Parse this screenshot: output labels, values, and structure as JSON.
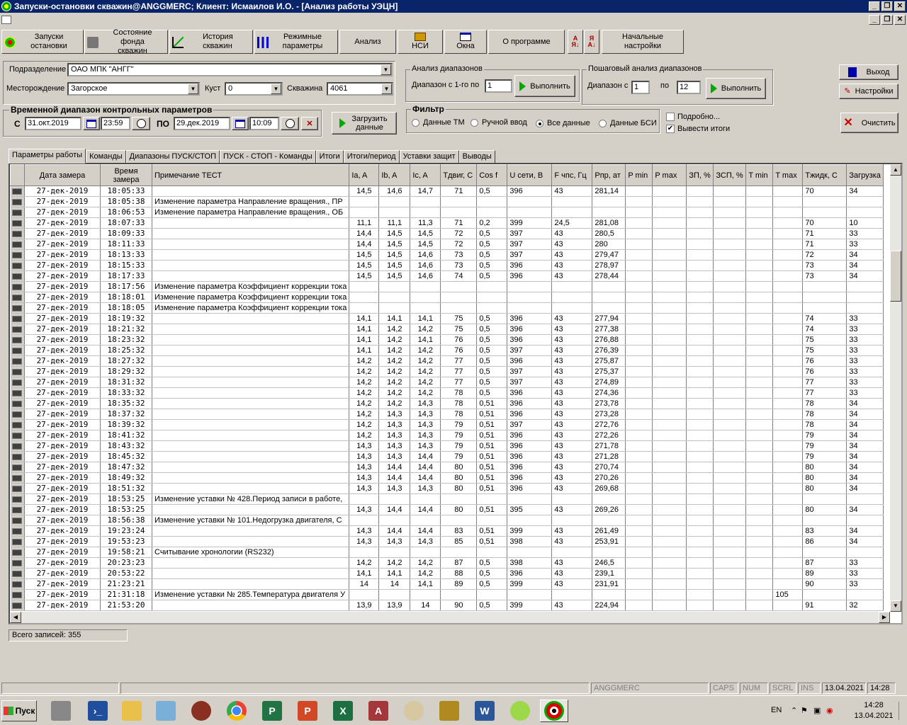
{
  "window": {
    "title": "Запуски-остановки скважин@ANGGMERC;  Клиент: Исмаилов И.О. - [Анализ работы УЭЦН]"
  },
  "toolbar": {
    "starts_stops": "Запуски остановки",
    "well_stock_state": "Состояние фонда скважин",
    "well_history": "История скважин",
    "mode_params": "Режимные параметры",
    "analysis": "Анализ",
    "nsi": "НСИ",
    "windows": "Окна",
    "about": "О программе",
    "initial_settings": "Начальные настройки"
  },
  "filters": {
    "subdivision_label": "Подразделение",
    "subdivision_value": "ОАО МПК \"АНГГ\"",
    "field_label": "Месторождение",
    "field_value": "Загорское",
    "cluster_label": "Куст",
    "cluster_value": "0",
    "well_label": "Скважина",
    "well_value": "4061"
  },
  "time_range": {
    "title": "Временной диапазон контрольных параметров",
    "from_label": "С",
    "from_date": "31.окт.2019",
    "from_time": "23:59",
    "to_label": "ПО",
    "to_date": "29.дек.2019",
    "to_time": "10:09",
    "load_button": "Загрузить данные"
  },
  "range_analysis": {
    "title": "Анализ диапазонов",
    "label": "Диапазон с 1-го по",
    "value": "1",
    "run": "Выполнить"
  },
  "step_analysis": {
    "title": "Пошаговый анализ диапазонов",
    "label_from": "Диапазон с",
    "from_value": "1",
    "label_to": "по",
    "to_value": "12",
    "run": "Выполнить"
  },
  "filter": {
    "title": "Фильтр",
    "options": [
      "Данные ТМ",
      "Ручной ввод",
      "Все данные",
      "Данные БСИ"
    ],
    "selected": "Все данные",
    "detailed_label": "Подробно...",
    "detailed_checked": false,
    "totals_label": "Вывести итоги",
    "totals_checked": true
  },
  "right_buttons": {
    "exit": "Выход",
    "settings": "Настройки",
    "clear": "Очистить"
  },
  "tabs": [
    "Параметры работы",
    "Команды",
    "Диапазоны ПУСК/СТОП",
    "ПУСК - СТОП - Команды",
    "Итоги",
    "Итоги/период",
    "Уставки защит",
    "Выводы"
  ],
  "active_tab": "Параметры работы",
  "grid": {
    "columns": [
      "Дата замера",
      "Время замера",
      "Примечание ТЕСТ",
      "Ia, A",
      "Ib, A",
      "Ic, A",
      "Тдвиг, С",
      "Cos f",
      "U сети, В",
      "F чпс, Гц",
      "Рпр, ат",
      "P min",
      "P max",
      "ЗП, %",
      "ЗСП, %",
      "T min",
      "T max",
      "Тжидк, С",
      "Загрузка"
    ],
    "rows": [
      [
        "27-дек-2019",
        "18:05:33",
        "",
        "14,5",
        "14,6",
        "14,7",
        "71",
        "0,5",
        "396",
        "43",
        "281,14",
        "",
        "",
        "",
        "",
        "",
        "",
        "70",
        "34"
      ],
      [
        "27-дек-2019",
        "18:05:38",
        "Изменение параметра Направление вращения.,   ПР",
        "",
        "",
        "",
        "",
        "",
        "",
        "",
        "",
        "",
        "",
        "",
        "",
        "",
        "",
        "",
        ""
      ],
      [
        "27-дек-2019",
        "18:06:53",
        "Изменение параметра Направление вращения.,   ОБ",
        "",
        "",
        "",
        "",
        "",
        "",
        "",
        "",
        "",
        "",
        "",
        "",
        "",
        "",
        "",
        ""
      ],
      [
        "27-дек-2019",
        "18:07:33",
        "",
        "11,1",
        "11,1",
        "11,3",
        "71",
        "0,2",
        "399",
        "24,5",
        "281,08",
        "",
        "",
        "",
        "",
        "",
        "",
        "70",
        "10"
      ],
      [
        "27-дек-2019",
        "18:09:33",
        "",
        "14,4",
        "14,5",
        "14,5",
        "72",
        "0,5",
        "397",
        "43",
        "280,5",
        "",
        "",
        "",
        "",
        "",
        "",
        "71",
        "33"
      ],
      [
        "27-дек-2019",
        "18:11:33",
        "",
        "14,4",
        "14,5",
        "14,5",
        "72",
        "0,5",
        "397",
        "43",
        "280",
        "",
        "",
        "",
        "",
        "",
        "",
        "71",
        "33"
      ],
      [
        "27-дек-2019",
        "18:13:33",
        "",
        "14,5",
        "14,5",
        "14,6",
        "73",
        "0,5",
        "397",
        "43",
        "279,47",
        "",
        "",
        "",
        "",
        "",
        "",
        "72",
        "34"
      ],
      [
        "27-дек-2019",
        "18:15:33",
        "",
        "14,5",
        "14,5",
        "14,6",
        "73",
        "0,5",
        "396",
        "43",
        "278,97",
        "",
        "",
        "",
        "",
        "",
        "",
        "73",
        "34"
      ],
      [
        "27-дек-2019",
        "18:17:33",
        "",
        "14,5",
        "14,5",
        "14,6",
        "74",
        "0,5",
        "396",
        "43",
        "278,44",
        "",
        "",
        "",
        "",
        "",
        "",
        "73",
        "34"
      ],
      [
        "27-дек-2019",
        "18:17:56",
        "Изменение параметра Коэффициент коррекции тока",
        "",
        "",
        "",
        "",
        "",
        "",
        "",
        "",
        "",
        "",
        "",
        "",
        "",
        "",
        "",
        ""
      ],
      [
        "27-дек-2019",
        "18:18:01",
        "Изменение параметра Коэффициент коррекции тока",
        "",
        "",
        "",
        "",
        "",
        "",
        "",
        "",
        "",
        "",
        "",
        "",
        "",
        "",
        "",
        ""
      ],
      [
        "27-дек-2019",
        "18:18:05",
        "Изменение параметра Коэффициент коррекции тока",
        "",
        "",
        "",
        "",
        "",
        "",
        "",
        "",
        "",
        "",
        "",
        "",
        "",
        "",
        "",
        ""
      ],
      [
        "27-дек-2019",
        "18:19:32",
        "",
        "14,1",
        "14,1",
        "14,1",
        "75",
        "0,5",
        "396",
        "43",
        "277,94",
        "",
        "",
        "",
        "",
        "",
        "",
        "74",
        "33"
      ],
      [
        "27-дек-2019",
        "18:21:32",
        "",
        "14,1",
        "14,2",
        "14,2",
        "75",
        "0,5",
        "396",
        "43",
        "277,38",
        "",
        "",
        "",
        "",
        "",
        "",
        "74",
        "33"
      ],
      [
        "27-дек-2019",
        "18:23:32",
        "",
        "14,1",
        "14,2",
        "14,1",
        "76",
        "0,5",
        "396",
        "43",
        "276,88",
        "",
        "",
        "",
        "",
        "",
        "",
        "75",
        "33"
      ],
      [
        "27-дек-2019",
        "18:25:32",
        "",
        "14,1",
        "14,2",
        "14,2",
        "76",
        "0,5",
        "397",
        "43",
        "276,39",
        "",
        "",
        "",
        "",
        "",
        "",
        "75",
        "33"
      ],
      [
        "27-дек-2019",
        "18:27:32",
        "",
        "14,2",
        "14,2",
        "14,2",
        "77",
        "0,5",
        "396",
        "43",
        "275,87",
        "",
        "",
        "",
        "",
        "",
        "",
        "76",
        "33"
      ],
      [
        "27-дек-2019",
        "18:29:32",
        "",
        "14,2",
        "14,2",
        "14,2",
        "77",
        "0,5",
        "397",
        "43",
        "275,37",
        "",
        "",
        "",
        "",
        "",
        "",
        "76",
        "33"
      ],
      [
        "27-дек-2019",
        "18:31:32",
        "",
        "14,2",
        "14,2",
        "14,2",
        "77",
        "0,5",
        "397",
        "43",
        "274,89",
        "",
        "",
        "",
        "",
        "",
        "",
        "77",
        "33"
      ],
      [
        "27-дек-2019",
        "18:33:32",
        "",
        "14,2",
        "14,2",
        "14,2",
        "78",
        "0,5",
        "396",
        "43",
        "274,36",
        "",
        "",
        "",
        "",
        "",
        "",
        "77",
        "33"
      ],
      [
        "27-дек-2019",
        "18:35:32",
        "",
        "14,2",
        "14,2",
        "14,3",
        "78",
        "0,51",
        "396",
        "43",
        "273,78",
        "",
        "",
        "",
        "",
        "",
        "",
        "78",
        "34"
      ],
      [
        "27-дек-2019",
        "18:37:32",
        "",
        "14,2",
        "14,3",
        "14,3",
        "78",
        "0,51",
        "396",
        "43",
        "273,28",
        "",
        "",
        "",
        "",
        "",
        "",
        "78",
        "34"
      ],
      [
        "27-дек-2019",
        "18:39:32",
        "",
        "14,2",
        "14,3",
        "14,3",
        "79",
        "0,51",
        "397",
        "43",
        "272,76",
        "",
        "",
        "",
        "",
        "",
        "",
        "78",
        "34"
      ],
      [
        "27-дек-2019",
        "18:41:32",
        "",
        "14,2",
        "14,3",
        "14,3",
        "79",
        "0,51",
        "396",
        "43",
        "272,26",
        "",
        "",
        "",
        "",
        "",
        "",
        "79",
        "34"
      ],
      [
        "27-дек-2019",
        "18:43:32",
        "",
        "14,3",
        "14,3",
        "14,3",
        "79",
        "0,51",
        "396",
        "43",
        "271,78",
        "",
        "",
        "",
        "",
        "",
        "",
        "79",
        "34"
      ],
      [
        "27-дек-2019",
        "18:45:32",
        "",
        "14,3",
        "14,3",
        "14,4",
        "79",
        "0,51",
        "396",
        "43",
        "271,28",
        "",
        "",
        "",
        "",
        "",
        "",
        "79",
        "34"
      ],
      [
        "27-дек-2019",
        "18:47:32",
        "",
        "14,3",
        "14,4",
        "14,4",
        "80",
        "0,51",
        "396",
        "43",
        "270,74",
        "",
        "",
        "",
        "",
        "",
        "",
        "80",
        "34"
      ],
      [
        "27-дек-2019",
        "18:49:32",
        "",
        "14,3",
        "14,4",
        "14,4",
        "80",
        "0,51",
        "396",
        "43",
        "270,26",
        "",
        "",
        "",
        "",
        "",
        "",
        "80",
        "34"
      ],
      [
        "27-дек-2019",
        "18:51:32",
        "",
        "14,3",
        "14,3",
        "14,3",
        "80",
        "0,51",
        "396",
        "43",
        "269,68",
        "",
        "",
        "",
        "",
        "",
        "",
        "80",
        "34"
      ],
      [
        "27-дек-2019",
        "18:53:25",
        "Изменение уставки № 428.Период записи  в работе,",
        "",
        "",
        "",
        "",
        "",
        "",
        "",
        "",
        "",
        "",
        "",
        "",
        "",
        "",
        "",
        ""
      ],
      [
        "27-дек-2019",
        "18:53:25",
        "",
        "14,3",
        "14,4",
        "14,4",
        "80",
        "0,51",
        "395",
        "43",
        "269,26",
        "",
        "",
        "",
        "",
        "",
        "",
        "80",
        "34"
      ],
      [
        "27-дек-2019",
        "18:56:38",
        "Изменение уставки № 101.Недогрузка двигателя,   С",
        "",
        "",
        "",
        "",
        "",
        "",
        "",
        "",
        "",
        "",
        "",
        "",
        "",
        "",
        "",
        ""
      ],
      [
        "27-дек-2019",
        "19:23:24",
        "",
        "14,3",
        "14,4",
        "14,4",
        "83",
        "0,51",
        "399",
        "43",
        "261,49",
        "",
        "",
        "",
        "",
        "",
        "",
        "83",
        "34"
      ],
      [
        "27-дек-2019",
        "19:53:23",
        "",
        "14,3",
        "14,3",
        "14,3",
        "85",
        "0,51",
        "398",
        "43",
        "253,91",
        "",
        "",
        "",
        "",
        "",
        "",
        "86",
        "34"
      ],
      [
        "27-дек-2019",
        "19:58:21",
        "Считывание хронологии (RS232)",
        "",
        "",
        "",
        "",
        "",
        "",
        "",
        "",
        "",
        "",
        "",
        "",
        "",
        "",
        "",
        ""
      ],
      [
        "27-дек-2019",
        "20:23:23",
        "",
        "14,2",
        "14,2",
        "14,2",
        "87",
        "0,5",
        "398",
        "43",
        "246,5",
        "",
        "",
        "",
        "",
        "",
        "",
        "87",
        "33"
      ],
      [
        "27-дек-2019",
        "20:53:22",
        "",
        "14,1",
        "14,1",
        "14,2",
        "88",
        "0,5",
        "396",
        "43",
        "239,1",
        "",
        "",
        "",
        "",
        "",
        "",
        "89",
        "33"
      ],
      [
        "27-дек-2019",
        "21:23:21",
        "",
        "14",
        "14",
        "14,1",
        "89",
        "0,5",
        "399",
        "43",
        "231,91",
        "",
        "",
        "",
        "",
        "",
        "",
        "90",
        "33"
      ],
      [
        "27-дек-2019",
        "21:31:18",
        "Изменение уставки № 285.Температура двигателя У",
        "",
        "",
        "",
        "",
        "",
        "",
        "",
        "",
        "",
        "",
        "",
        "",
        "",
        "105",
        "",
        ""
      ],
      [
        "27-дек-2019",
        "21:53:20",
        "",
        "13,9",
        "13,9",
        "14",
        "90",
        "0,5",
        "399",
        "43",
        "224,94",
        "",
        "",
        "",
        "",
        "",
        "",
        "91",
        "32"
      ]
    ]
  },
  "records": {
    "label": "Всего записей: 355"
  },
  "statusbar": {
    "server": "ANGGMERC",
    "caps": "CAPS",
    "num": "NUM",
    "scrl": "SCRL",
    "ins": "INS",
    "date": "13.04.2021",
    "time": "14:28"
  },
  "taskbar": {
    "start": "Пуск",
    "lang": "EN",
    "clock_time": "14:28",
    "clock_date": "13.04.2021"
  }
}
